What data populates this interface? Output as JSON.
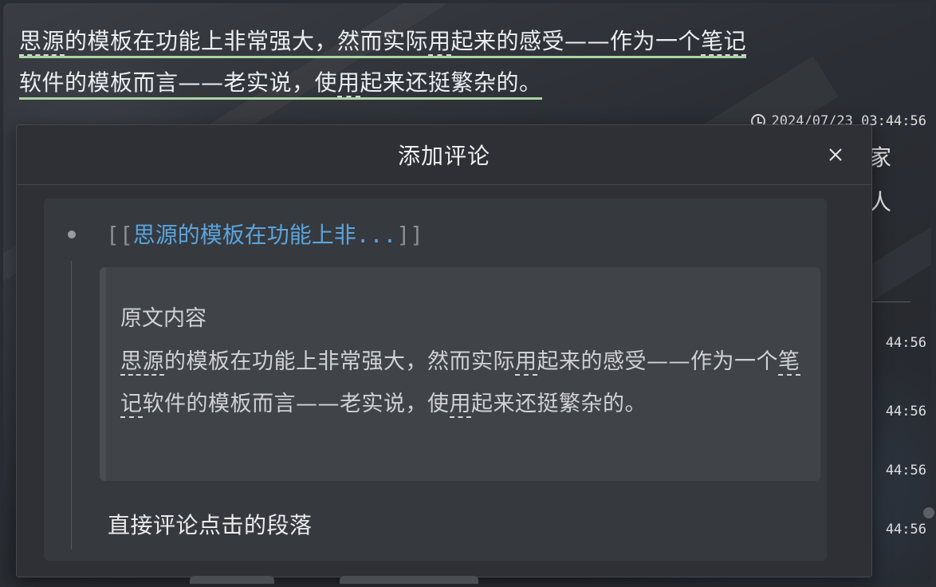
{
  "document": {
    "paragraph": {
      "seg1": "思源",
      "seg2": "的模板在功能上非常强大，然而实际",
      "seg3": "用",
      "seg4": "起来的感受——作为一个",
      "seg5": "笔记",
      "seg6": "软件的模板而言——老实说，使",
      "seg7": "用",
      "seg8": "起来还挺繁杂的。"
    },
    "timestamp_top": "2024/07/23 03:44:56",
    "timestamps_side": [
      "44:56",
      "44:56",
      "44:56",
      "44:56"
    ],
    "peek_chars": [
      "家",
      "人"
    ]
  },
  "dialog": {
    "title": "添加评论",
    "close_icon": "close-icon",
    "reference": {
      "open": "[[",
      "link_text": "思源的模板在功能上非",
      "ellipsis": "...",
      "close": "]]"
    },
    "quote": {
      "title": "原文内容",
      "seg1": "思源",
      "seg2": "的模板在功能上非常强大，然而实际",
      "seg3": "用",
      "seg4": "起来的感受——作为一个",
      "seg5": "笔记",
      "seg6": "软件的模板而言——老实说，使",
      "seg7": "用",
      "seg8": "起来还挺繁杂的。"
    },
    "comment_label": "直接评论点击的段落"
  },
  "colors": {
    "highlight_underline": "#a8d5a2",
    "link": "#5ba4dd",
    "dialog_bg": "#2e3035",
    "card_bg": "#36393e",
    "quote_bg": "#404348"
  }
}
